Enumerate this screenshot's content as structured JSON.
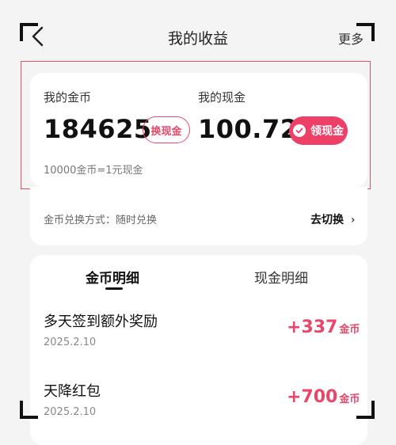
{
  "header": {
    "title": "我的收益",
    "more_label": "更多"
  },
  "summary": {
    "coins_label": "我的金币",
    "coins_value": "184625",
    "exchange_button": "换现金",
    "cash_label": "我的现金",
    "cash_value": "100.72",
    "claim_button": "领现金",
    "rate_text": "10000金币=1元现金"
  },
  "exchange_mode": {
    "text": "金币兑换方式：随时兑换",
    "switch_label": "去切换"
  },
  "tabs": [
    {
      "label": "金币明细",
      "active": true
    },
    {
      "label": "现金明细",
      "active": false
    }
  ],
  "records": [
    {
      "title": "多天签到额外奖励",
      "date": "2025.2.10",
      "amount": "+337",
      "unit": "金币"
    },
    {
      "title": "天降红包",
      "date": "2025.2.10",
      "amount": "+700",
      "unit": "金币"
    }
  ],
  "colors": {
    "accent": "#ee3f66",
    "highlight_border": "#e25563",
    "background": "#f4f4f4"
  }
}
